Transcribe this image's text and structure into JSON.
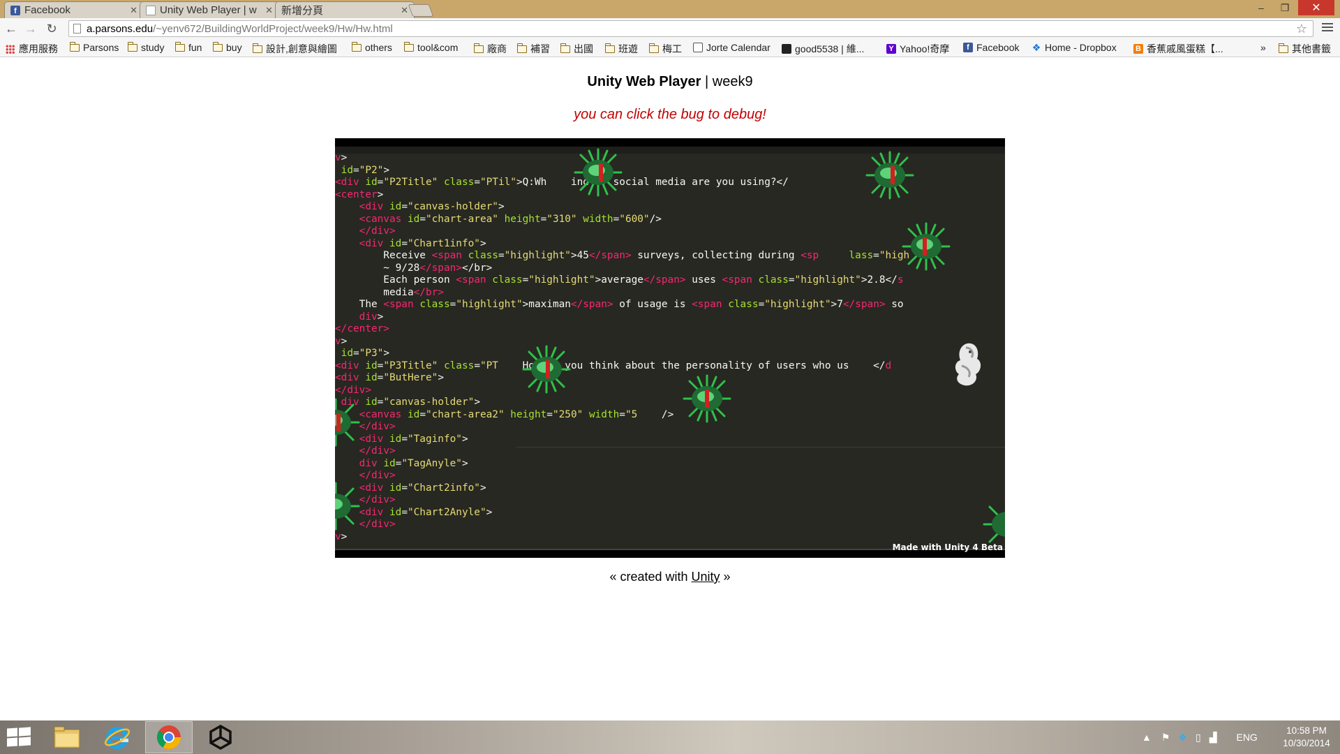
{
  "browser": {
    "tabs": [
      {
        "title": "Facebook",
        "icon": "facebook-icon",
        "active": false
      },
      {
        "title": "Unity Web Player | w",
        "icon": "page-icon",
        "active": true
      },
      {
        "title": "新增分頁",
        "icon": "none",
        "active": false
      }
    ],
    "url_host": "a.parsons.edu",
    "url_path": "/~yenv672/BuildingWorldProject/week9/Hw/Hw.html",
    "window_controls": {
      "minimize": "–",
      "maximize": "❐",
      "close": "✕"
    }
  },
  "bookmarks": [
    {
      "label": "應用服務",
      "icon": "apps-icon"
    },
    {
      "label": "Parsons",
      "icon": "folder-icon"
    },
    {
      "label": "study",
      "icon": "folder-icon"
    },
    {
      "label": "fun",
      "icon": "folder-icon"
    },
    {
      "label": "buy",
      "icon": "folder-icon"
    },
    {
      "label": "設計,創意與繪圖",
      "icon": "folder-icon"
    },
    {
      "label": "others",
      "icon": "folder-icon"
    },
    {
      "label": "tool&com",
      "icon": "folder-icon"
    },
    {
      "label": "廠商",
      "icon": "folder-icon"
    },
    {
      "label": "補習",
      "icon": "folder-icon"
    },
    {
      "label": "出國",
      "icon": "folder-icon"
    },
    {
      "label": "班遊",
      "icon": "folder-icon"
    },
    {
      "label": "梅工",
      "icon": "folder-icon"
    },
    {
      "label": "Jorte Calendar",
      "icon": "calendar-icon"
    },
    {
      "label": "good5538 | 維...",
      "icon": "bookmark-icon"
    },
    {
      "label": "Yahoo!奇摩",
      "icon": "yahoo-icon"
    },
    {
      "label": "Facebook",
      "icon": "facebook-icon"
    },
    {
      "label": "Home - Dropbox",
      "icon": "dropbox-icon"
    },
    {
      "label": "香蕉戚風蛋糕【...",
      "icon": "blogger-icon"
    }
  ],
  "bookmarks_overflow": "»",
  "bookmarks_other": "其他書籤",
  "page": {
    "title_bold": "Unity Web Player",
    "title_sep": " | ",
    "title_rest": "week9",
    "hint": "you can click the bug to debug!",
    "unity_badge": "Made with Unity 4 Beta",
    "created_prefix": "« created with ",
    "created_link": "Unity",
    "created_suffix": " »"
  },
  "taskbar": {
    "apps": [
      "file-explorer-icon",
      "internet-explorer-icon",
      "chrome-icon",
      "unity-icon"
    ],
    "language": "ENG",
    "time": "10:58 PM",
    "date": "10/30/2014"
  },
  "colors": {
    "hint": "#c40000",
    "code_bg": "#272822",
    "keyword": "#f92672",
    "attr": "#a6e22e",
    "string": "#e6db74"
  }
}
